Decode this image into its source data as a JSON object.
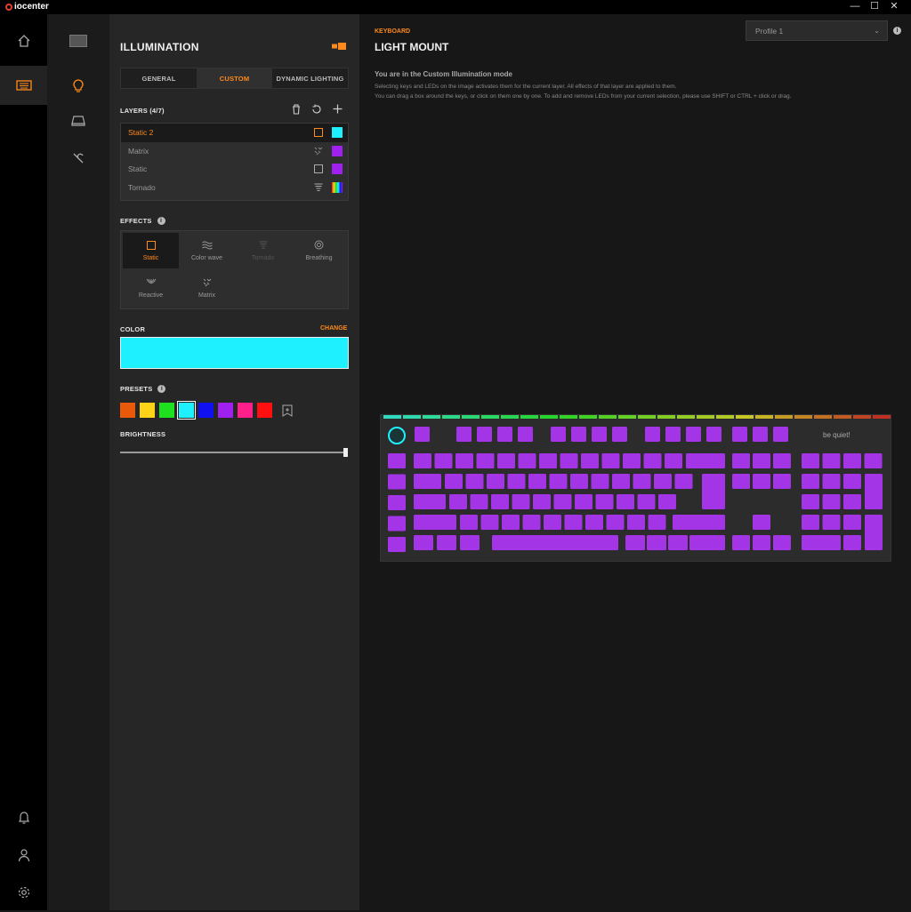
{
  "app": {
    "name": "iocenter",
    "window_buttons": [
      "—",
      "☐",
      "✕"
    ]
  },
  "rail": {
    "items": [
      "home-icon",
      "keyboard-icon"
    ],
    "bottom": [
      "bell-icon",
      "user-icon",
      "gear-icon"
    ],
    "active": "keyboard-icon"
  },
  "subnav": {
    "items": [
      "keyboard-thumb",
      "bulb-icon",
      "keyboard-device-icon",
      "wrench-icon"
    ],
    "active": "bulb-icon"
  },
  "panel": {
    "title": "ILLUMINATION",
    "tabs": [
      {
        "label": "GENERAL",
        "active": false
      },
      {
        "label": "CUSTOM",
        "active": true
      },
      {
        "label": "DYNAMIC LIGHTING",
        "active": false
      }
    ],
    "layers_label": "LAYERS (4/7)",
    "layers": [
      {
        "name": "Static 2",
        "selected": true,
        "icon": "square-icon",
        "color": "#1ff0ff"
      },
      {
        "name": "Matrix",
        "selected": false,
        "icon": "matrix-icon",
        "color": "#a020f0"
      },
      {
        "name": "Static",
        "selected": false,
        "icon": "square-icon",
        "color": "#a020f0"
      },
      {
        "name": "Tornado",
        "selected": false,
        "icon": "tornado-icon",
        "color": "rainbow"
      }
    ],
    "effects_label": "EFFECTS",
    "effects": [
      {
        "label": "Static",
        "icon": "square-icon",
        "state": "selected"
      },
      {
        "label": "Color wave",
        "icon": "wave-icon",
        "state": "normal"
      },
      {
        "label": "Tornado",
        "icon": "tornado-icon",
        "state": "disabled"
      },
      {
        "label": "Breathing",
        "icon": "breathing-icon",
        "state": "normal"
      },
      {
        "label": "Reactive",
        "icon": "reactive-icon",
        "state": "normal"
      },
      {
        "label": "Matrix",
        "icon": "matrix-icon",
        "state": "normal"
      }
    ],
    "color_label": "COLOR",
    "change_label": "CHANGE",
    "current_color": "#1ff0ff",
    "presets_label": "PRESETS",
    "presets": [
      "#e85a0a",
      "#ffd21a",
      "#1fe01f",
      "#1ff0ff",
      "#1010f0",
      "#a020f0",
      "#ff1f8a",
      "#ff1010"
    ],
    "selected_preset": 3,
    "brightness_label": "BRIGHTNESS",
    "brightness": 1.0
  },
  "main": {
    "crumb": "KEYBOARD",
    "title": "LIGHT MOUNT",
    "profile": "Profile 1",
    "mode_heading": "You are in the Custom Illumination mode",
    "mode_lines": [
      "Selecting keys and LEDs on the image activates them for the current layer. All effects of that layer are applied to them.",
      "You can drag a box around the keys, or click on them one by one. To add and remove LEDs from your current selection, please use SHIFT or CTRL + click or drag."
    ],
    "keyboard_brand": "be quiet!",
    "key_color": "#a335e6",
    "accent_color": "#ff8a1c"
  }
}
